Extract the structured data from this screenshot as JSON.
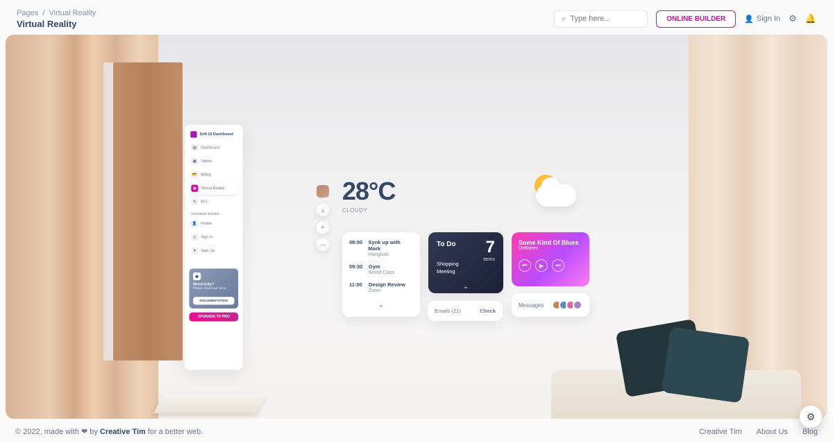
{
  "breadcrumb": {
    "root": "Pages",
    "current": "Virtual Reality"
  },
  "page_title": "Virtual Reality",
  "search": {
    "placeholder": "Type here..."
  },
  "builder_btn": "ONLINE BUILDER",
  "signin": "Sign In",
  "sidenav": {
    "brand": "Soft UI Dashboard",
    "items": [
      {
        "label": "Dashboard",
        "icon": "▤"
      },
      {
        "label": "Tables",
        "icon": "▦"
      },
      {
        "label": "Billing",
        "icon": "💳"
      },
      {
        "label": "Virtual Reality",
        "icon": "▣",
        "active": true
      },
      {
        "label": "RTL",
        "icon": "✎"
      }
    ],
    "section": "Account Pages",
    "account_items": [
      {
        "label": "Profile",
        "icon": "👤"
      },
      {
        "label": "Sign In",
        "icon": "◇"
      },
      {
        "label": "Sign Up",
        "icon": "✦"
      }
    ],
    "help": {
      "title": "Need help?",
      "sub": "Please check our docs",
      "btn": "DOCUMENTATION"
    },
    "upgrade": "UPGRADE TO PRO"
  },
  "weather": {
    "temp": "28°C",
    "cond": "CLOUDY"
  },
  "schedule": [
    {
      "time": "08:00",
      "title": "Synk up with Mark",
      "sub": "Hangouts"
    },
    {
      "time": "09:30",
      "title": "Gym",
      "sub": "World Class"
    },
    {
      "time": "11:00",
      "title": "Design Review",
      "sub": "Zoom"
    }
  ],
  "todo": {
    "title": "To Do",
    "count": "7",
    "items_label": "items",
    "list": [
      "Shopping",
      "Meeting"
    ]
  },
  "music": {
    "title": "Some Kind Of Blues",
    "artist": "Deftones"
  },
  "emails": {
    "label": "Emails (21)",
    "action": "Check"
  },
  "messages": {
    "label": "Messages"
  },
  "footer": {
    "copyright_prefix": "© 2022, made with ",
    "copyright_middle": " by ",
    "brand": "Creative Tim",
    "copyright_suffix": " for a better web.",
    "links": [
      "Creative Tim",
      "About Us",
      "Blog"
    ]
  }
}
